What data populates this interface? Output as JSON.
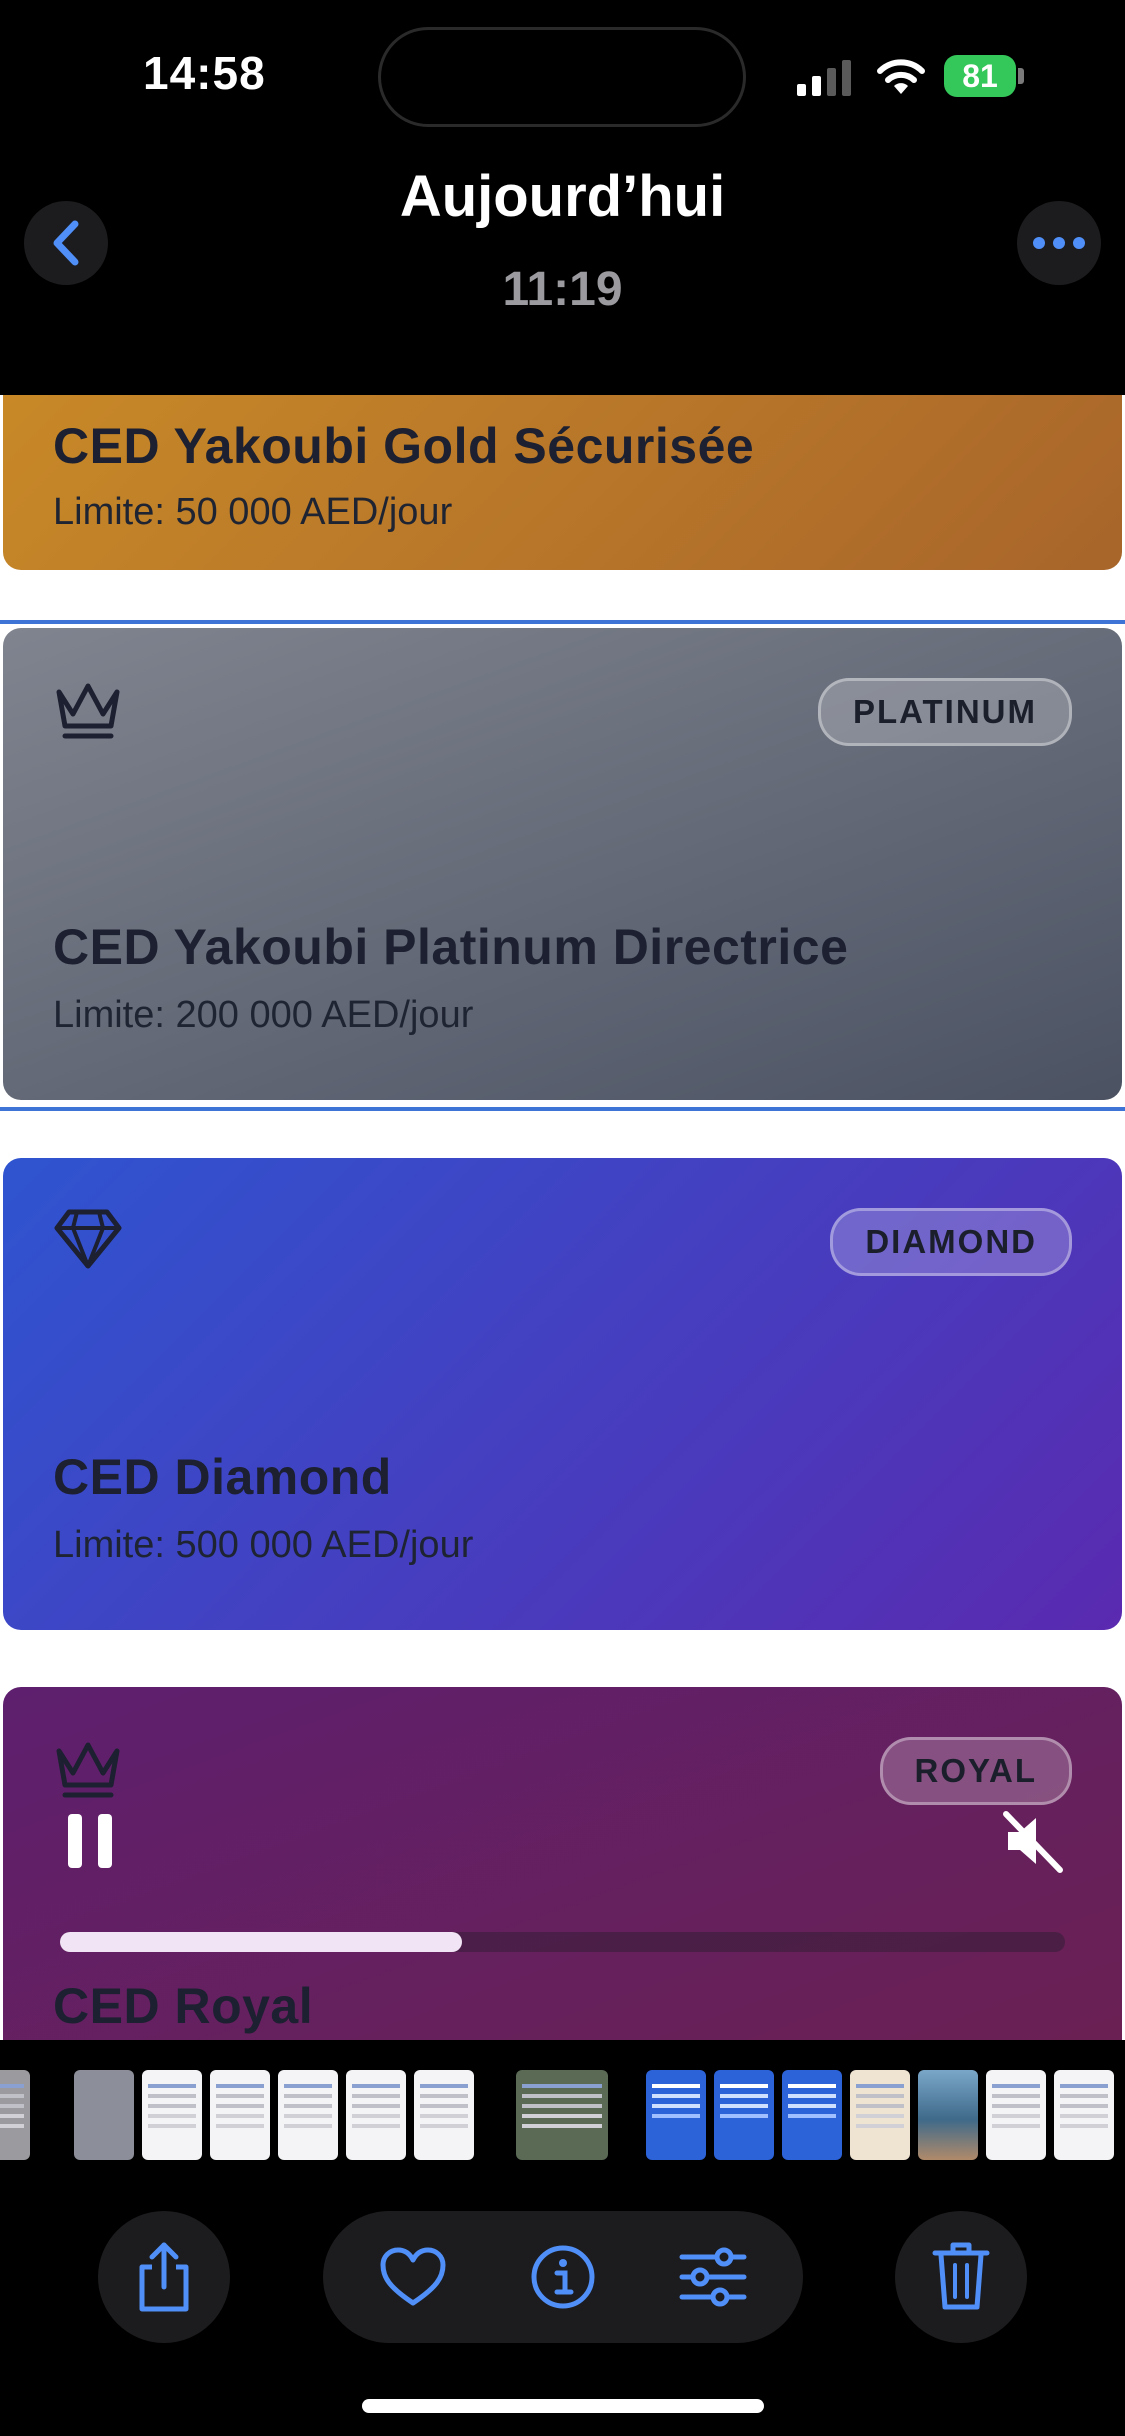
{
  "status_bar": {
    "time": "14:58",
    "battery": "81"
  },
  "header": {
    "title": "Aujourd’hui",
    "subtitle": "11:19"
  },
  "cards": {
    "gold": {
      "name": "CED Yakoubi Gold Sécurisée",
      "limit": "Limite: 50 000 AED/jour"
    },
    "platinum": {
      "badge": "PLATINUM",
      "name": "CED Yakoubi Platinum Directrice",
      "limit": "Limite: 200 000 AED/jour",
      "icon": "crown-icon"
    },
    "diamond": {
      "badge": "DIAMOND",
      "name": "CED Diamond",
      "limit": "Limite: 500 000 AED/jour",
      "icon": "diamond-icon"
    },
    "royal": {
      "badge": "ROYAL",
      "name": "CED Royal",
      "icon": "crown-icon"
    }
  },
  "video": {
    "progress": 0.4,
    "state": "playing",
    "muted": true
  },
  "toolbar": {
    "icons": [
      "share-icon",
      "heart-icon",
      "info-icon",
      "adjust-icon",
      "trash-icon"
    ]
  },
  "colors": {
    "accent": "#4f8ff7",
    "gold": "#c98a28",
    "platinum": "#6a707d",
    "diamond": "#4a3cc8",
    "royal": "#5e1f6e"
  }
}
